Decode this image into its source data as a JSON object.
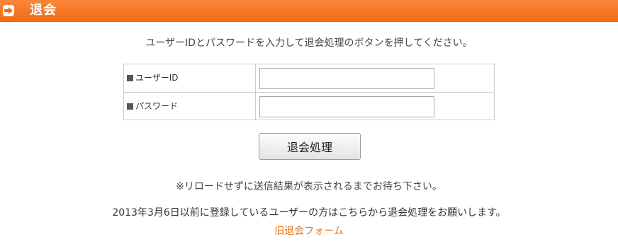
{
  "header": {
    "icon": "arrow-right-icon",
    "title": "退会",
    "colors": {
      "bar": "#f06a10",
      "text": "#ffffff"
    }
  },
  "instruction": "ユーザーIDとパスワードを入力して退会処理のボタンを押してください。",
  "form": {
    "userid_label": "ユーザーID",
    "userid_value": "",
    "password_label": "パスワード",
    "password_value": ""
  },
  "submit_label": "退会処理",
  "note": "※リロードせずに送信結果が表示されるまでお待ち下さい。",
  "old_form": {
    "text": "2013年3月6日以前に登録しているユーザーの方はこちらから退会処理をお願いします。",
    "link_label": "旧退会フォーム",
    "link_color": "#e8731a"
  }
}
